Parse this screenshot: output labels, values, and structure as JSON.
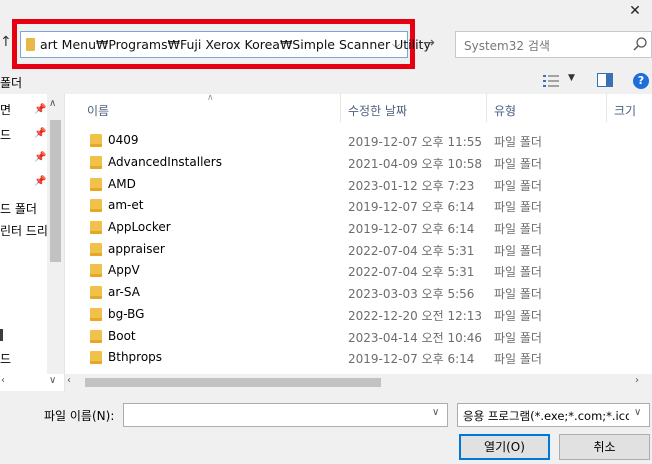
{
  "window": {
    "close_glyph": "✕"
  },
  "address_bar": {
    "path": "art Menu₩Programs₩Fuji Xerox Korea₩Simple Scanner Utility",
    "highlight_color": "#e60012"
  },
  "search": {
    "placeholder": "System32 검색"
  },
  "toolbar": {
    "new_folder_label": "폴더"
  },
  "nav_pane": {
    "items": [
      {
        "label": "면",
        "pinned": true
      },
      {
        "label": "드",
        "pinned": true
      },
      {
        "label": "",
        "pinned": true
      },
      {
        "label": "",
        "pinned": true
      },
      {
        "label": "드 폴더",
        "pinned": false
      },
      {
        "label": "린터 드리",
        "pinned": false
      },
      {
        "label": "",
        "pinned": false
      },
      {
        "label": "드",
        "pinned": false
      }
    ]
  },
  "columns": {
    "name": "이름",
    "date": "수정한 날짜",
    "type": "유형",
    "size": "크기"
  },
  "files": [
    {
      "name": "0409",
      "date": "2019-12-07 오후 11:55",
      "type": "파일 폴더"
    },
    {
      "name": "AdvancedInstallers",
      "date": "2021-04-09 오후 10:58",
      "type": "파일 폴더"
    },
    {
      "name": "AMD",
      "date": "2023-01-12 오후 7:23",
      "type": "파일 폴더"
    },
    {
      "name": "am-et",
      "date": "2019-12-07 오후 6:14",
      "type": "파일 폴더"
    },
    {
      "name": "AppLocker",
      "date": "2019-12-07 오후 6:14",
      "type": "파일 폴더"
    },
    {
      "name": "appraiser",
      "date": "2022-07-04 오후 5:31",
      "type": "파일 폴더"
    },
    {
      "name": "AppV",
      "date": "2022-07-04 오후 5:31",
      "type": "파일 폴더"
    },
    {
      "name": "ar-SA",
      "date": "2023-03-03 오후 5:56",
      "type": "파일 폴더"
    },
    {
      "name": "bg-BG",
      "date": "2022-12-20 오전 12:13",
      "type": "파일 폴더"
    },
    {
      "name": "Boot",
      "date": "2023-04-14 오전 10:46",
      "type": "파일 폴더"
    },
    {
      "name": "Bthprops",
      "date": "2019-12-07 오후 6:14",
      "type": "파일 폴더"
    }
  ],
  "bottom": {
    "filename_label": "파일 이름(N):",
    "filename_value": "",
    "file_type": "응용 프로그램(*.exe;*.com;*.icd)",
    "open_label": "열기(O)",
    "cancel_label": "취소"
  }
}
